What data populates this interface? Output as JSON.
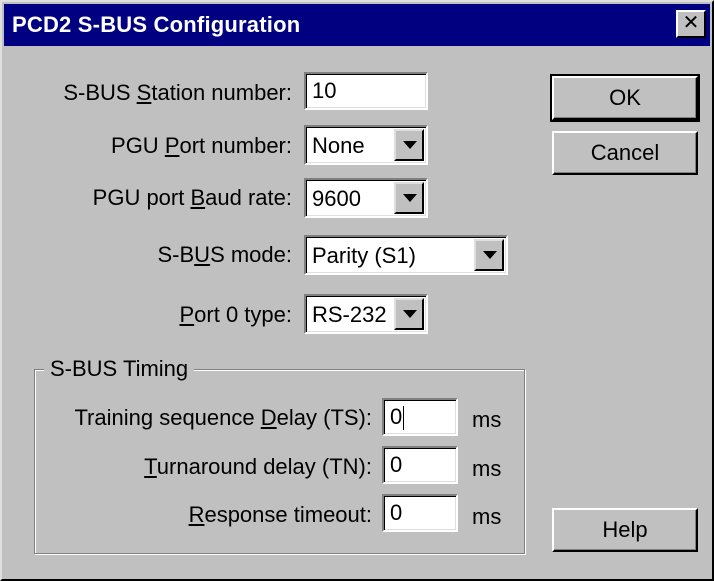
{
  "window": {
    "title": "PCD2 S-BUS Configuration",
    "close_glyph": "✕"
  },
  "fields": {
    "station": {
      "label_pre": "S-BUS ",
      "label_acc": "S",
      "label_post": "tation number:",
      "value": "10"
    },
    "pgu_port": {
      "label_pre": "PGU ",
      "label_acc": "P",
      "label_post": "ort number:",
      "value": "None"
    },
    "baud": {
      "label_pre": "PGU port ",
      "label_acc": "B",
      "label_post": "aud rate:",
      "value": "9600"
    },
    "mode": {
      "label_pre": "S-B",
      "label_acc": "U",
      "label_post": "S mode:",
      "value": "Parity (S1)"
    },
    "port0": {
      "label_pre": "",
      "label_acc": "P",
      "label_post": "ort 0 type:",
      "value": "RS-232"
    }
  },
  "timing": {
    "title": "S-BUS Timing",
    "ts": {
      "label_pre": "Training sequence ",
      "label_acc": "D",
      "label_post": "elay (TS):",
      "value": "0",
      "unit": "ms"
    },
    "tn": {
      "label_pre": "",
      "label_acc": "T",
      "label_post": "urnaround delay (TN):",
      "value": "0",
      "unit": "ms"
    },
    "resp": {
      "label_pre": "",
      "label_acc": "R",
      "label_post": "esponse timeout:",
      "value": "0",
      "unit": "ms"
    }
  },
  "buttons": {
    "ok": "OK",
    "cancel": "Cancel",
    "help": "Help"
  }
}
